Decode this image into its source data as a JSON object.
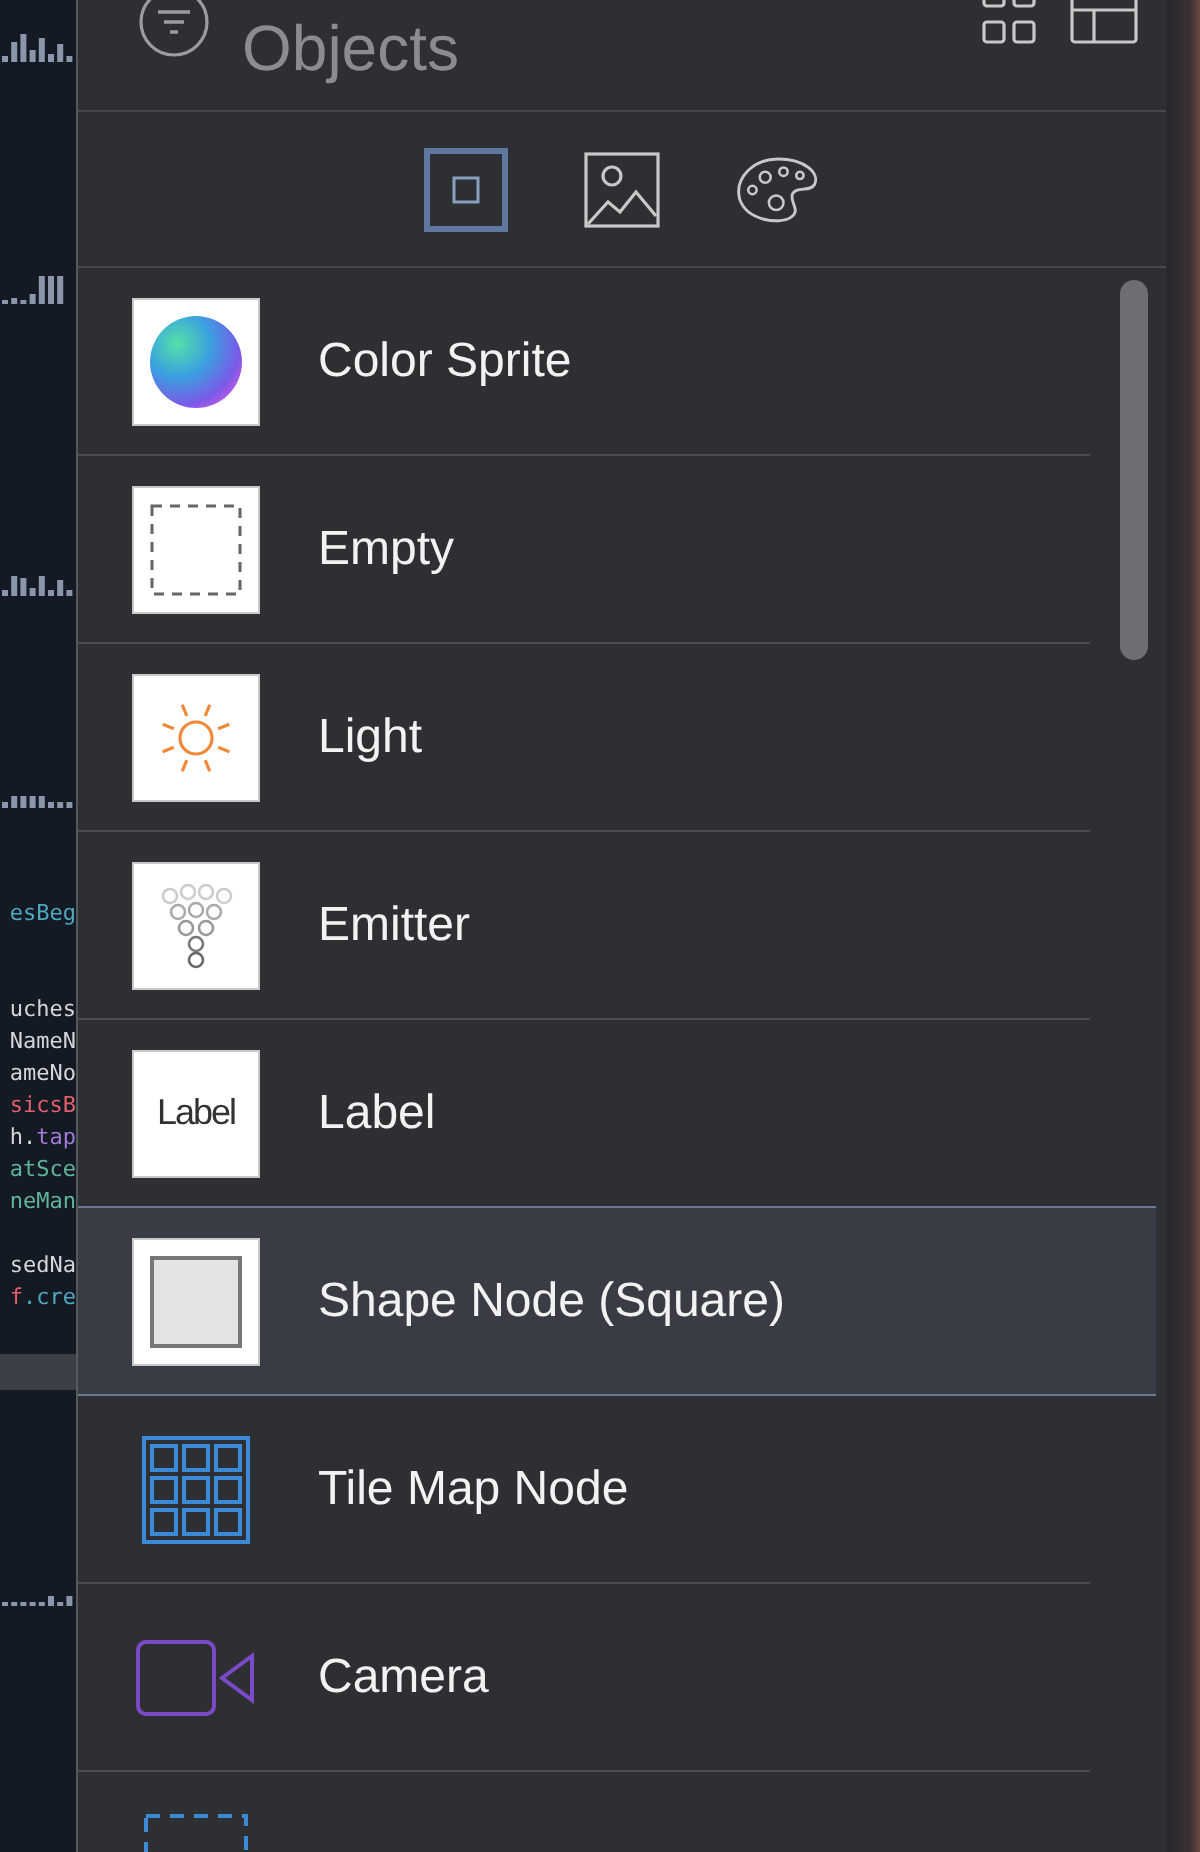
{
  "code_blocks": [
    [
      {
        "segments": [
          {
            "text": "esBeg",
            "color": "#4fa8c0"
          }
        ]
      }
    ],
    [
      {
        "segments": [
          {
            "text": "uches",
            "color": "#d4d6da"
          }
        ]
      },
      {
        "segments": [
          {
            "text": "NameN",
            "color": "#d4d6da"
          }
        ]
      },
      {
        "segments": [
          {
            "text": "ameNo",
            "color": "#d4d6da"
          }
        ]
      },
      {
        "segments": [
          {
            "text": "sicsB",
            "color": "#e0606a"
          }
        ]
      },
      {
        "segments": [
          {
            "text": "h.",
            "color": "#d4d6da"
          },
          {
            "text": "tap",
            "color": "#a27ad8"
          }
        ]
      },
      {
        "segments": [
          {
            "text": "atSce",
            "color": "#5fb39f"
          }
        ]
      },
      {
        "segments": [
          {
            "text": "neMan",
            "color": "#5fb39f"
          }
        ]
      }
    ],
    [
      {
        "segments": [
          {
            "text": "sedNa",
            "color": "#d4d6da"
          }
        ]
      },
      {
        "segments": [
          {
            "text": "f",
            "color": "#e0606a"
          },
          {
            "text": ".cre",
            "color": "#4fa8c0"
          }
        ]
      }
    ]
  ],
  "panel": {
    "title": "Objects",
    "tabs": [
      {
        "kind": "objects",
        "selected": true
      },
      {
        "kind": "media",
        "selected": false
      },
      {
        "kind": "colors",
        "selected": false
      }
    ],
    "items": [
      {
        "kind": "sprite",
        "label": "Color Sprite",
        "selected": false
      },
      {
        "kind": "empty",
        "label": "Empty",
        "selected": false
      },
      {
        "kind": "light",
        "label": "Light",
        "selected": false
      },
      {
        "kind": "emitter",
        "label": "Emitter",
        "selected": false
      },
      {
        "kind": "label",
        "label": "Label",
        "icon_text": "Label",
        "selected": false
      },
      {
        "kind": "shape",
        "label": "Shape Node (Square)",
        "selected": true
      },
      {
        "kind": "tilemap",
        "label": "Tile Map Node",
        "selected": false
      },
      {
        "kind": "camera",
        "label": "Camera",
        "selected": false
      },
      {
        "kind": "reference",
        "selected": false
      }
    ]
  }
}
